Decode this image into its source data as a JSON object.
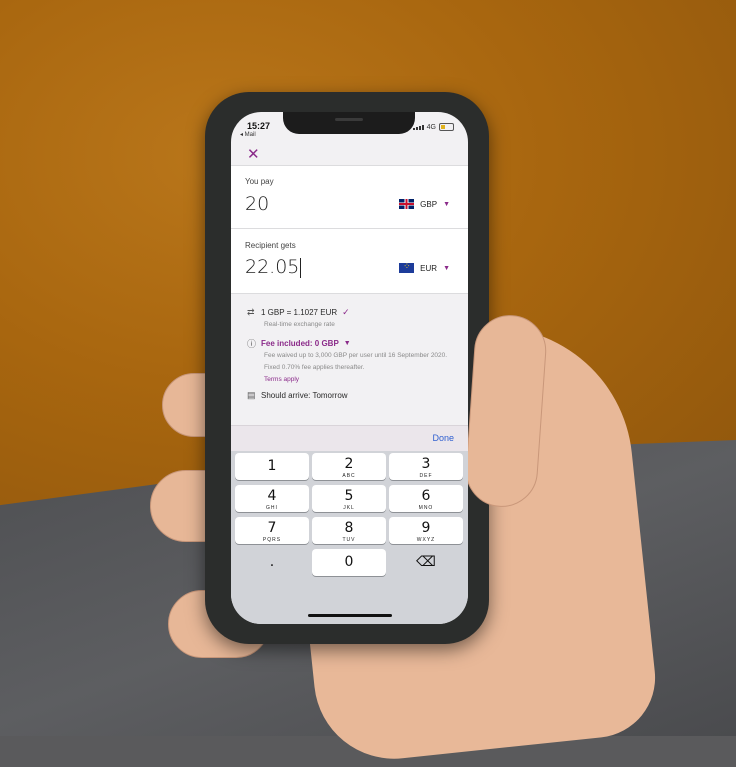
{
  "status_bar": {
    "time": "15:27",
    "back_label": "◂ Mail",
    "network": "4G"
  },
  "close_icon": "close-icon",
  "you_pay": {
    "label": "You pay",
    "amount": "20",
    "currency": "GBP"
  },
  "recipient_gets": {
    "label": "Recipient gets",
    "amount": "22.05",
    "currency": "EUR"
  },
  "rate": {
    "text": "1 GBP = 1.1027 EUR",
    "sub": "Real-time exchange rate"
  },
  "fee": {
    "label": "Fee included: 0 GBP",
    "description": "Fee waived up to 3,000 GBP per user until 16 September 2020. Fixed 0.70% fee applies thereafter.",
    "link": "Terms apply"
  },
  "arrival": {
    "text": "Should arrive: Tomorrow"
  },
  "toolbar": {
    "done_label": "Done"
  },
  "keypad": {
    "keys": [
      {
        "num": "1",
        "letters": ""
      },
      {
        "num": "2",
        "letters": "ABC"
      },
      {
        "num": "3",
        "letters": "DEF"
      },
      {
        "num": "4",
        "letters": "GHI"
      },
      {
        "num": "5",
        "letters": "JKL"
      },
      {
        "num": "6",
        "letters": "MNO"
      },
      {
        "num": "7",
        "letters": "PQRS"
      },
      {
        "num": "8",
        "letters": "TUV"
      },
      {
        "num": "9",
        "letters": "WXYZ"
      },
      {
        "num": ".",
        "letters": ""
      },
      {
        "num": "0",
        "letters": ""
      }
    ]
  },
  "colors": {
    "accent": "#8b2b8a",
    "done": "#2f5fd0"
  }
}
